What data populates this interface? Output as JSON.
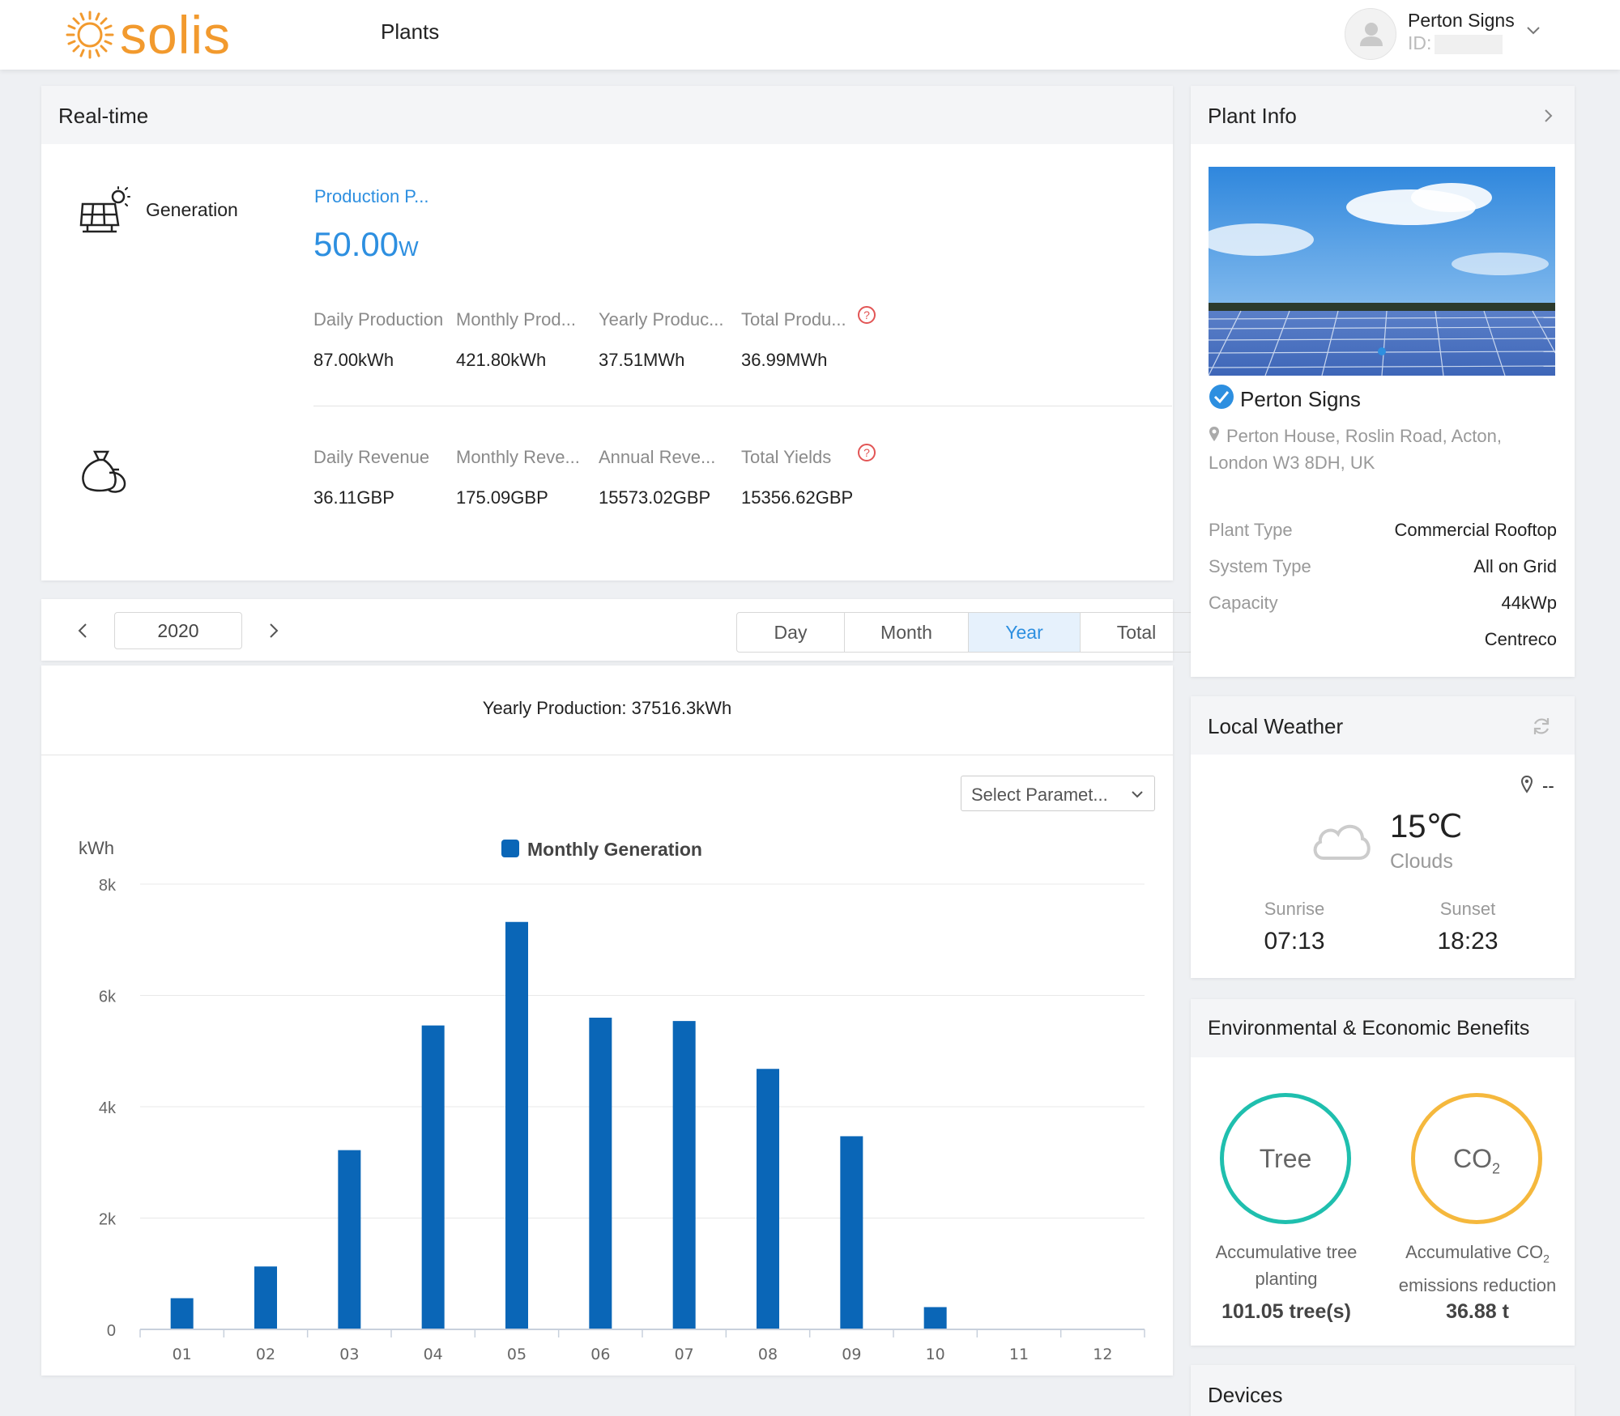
{
  "header": {
    "logo_text": "solis",
    "nav_plants": "Plants",
    "user_name": "Perton Signs",
    "user_id_label": "ID:"
  },
  "realtime": {
    "title": "Real-time",
    "generation_label": "Generation",
    "production_power_label": "Production P...",
    "production_power_value": "50.00",
    "production_power_unit": "W",
    "production": [
      {
        "label": "Daily Production",
        "value": "87.00kWh"
      },
      {
        "label": "Monthly Prod...",
        "value": "421.80kWh"
      },
      {
        "label": "Yearly Produc...",
        "value": "37.51MWh"
      },
      {
        "label": "Total Produ...",
        "value": "36.99MWh"
      }
    ],
    "revenue": [
      {
        "label": "Daily Revenue",
        "value": "36.11GBP"
      },
      {
        "label": "Monthly Reve...",
        "value": "175.09GBP"
      },
      {
        "label": "Annual Reve...",
        "value": "15573.02GBP"
      },
      {
        "label": "Total Yields",
        "value": "15356.62GBP"
      }
    ],
    "help_glyph": "?"
  },
  "period": {
    "year": "2020",
    "tabs": [
      "Day",
      "Month",
      "Year",
      "Total"
    ],
    "active_tab": "Year",
    "summary": "Yearly Production: 37516.3kWh",
    "select_placeholder": "Select Paramet..."
  },
  "chart_data": {
    "type": "bar",
    "ylabel": "kWh",
    "legend": "Monthly Generation",
    "legend_position": "top-center",
    "color": "#0a66b7",
    "categories": [
      "01",
      "02",
      "03",
      "04",
      "05",
      "06",
      "07",
      "08",
      "09",
      "10",
      "11",
      "12"
    ],
    "series": [
      {
        "name": "Monthly Generation",
        "values": [
          560,
          1130,
          3220,
          5460,
          7320,
          5600,
          5540,
          4680,
          3470,
          400,
          0,
          0
        ]
      }
    ],
    "yticks": [
      "0",
      "2k",
      "4k",
      "6k",
      "8k"
    ],
    "ylim": [
      0,
      8000
    ],
    "grid": true
  },
  "plant_info": {
    "title": "Plant Info",
    "name": "Perton Signs",
    "address": "Perton House, Roslin Road, Acton, London W3 8DH, UK",
    "rows": [
      {
        "key": "Plant Type",
        "value": "Commercial Rooftop"
      },
      {
        "key": "System Type",
        "value": "All on Grid"
      },
      {
        "key": "Capacity",
        "value": "44kWp"
      },
      {
        "key": "",
        "value": "Centreco"
      }
    ]
  },
  "weather": {
    "title": "Local Weather",
    "location": "--",
    "temperature": "15℃",
    "condition": "Clouds",
    "sunrise_label": "Sunrise",
    "sunrise": "07:13",
    "sunset_label": "Sunset",
    "sunset": "18:23"
  },
  "benefits": {
    "title": "Environmental & Economic Benefits",
    "tree_ring": "Tree",
    "tree_text": "Accumulative tree planting",
    "tree_value": "101.05 tree(s)",
    "co2_ring": "CO",
    "co2_ring_sub": "2",
    "co2_text_a": "Accumulative CO",
    "co2_text_sub": "2",
    "co2_text_b": "emissions reduction",
    "co2_value": "36.88 t",
    "tree_color": "#1fbfae",
    "co2_color": "#f5b83d"
  },
  "devices": {
    "title": "Devices"
  }
}
